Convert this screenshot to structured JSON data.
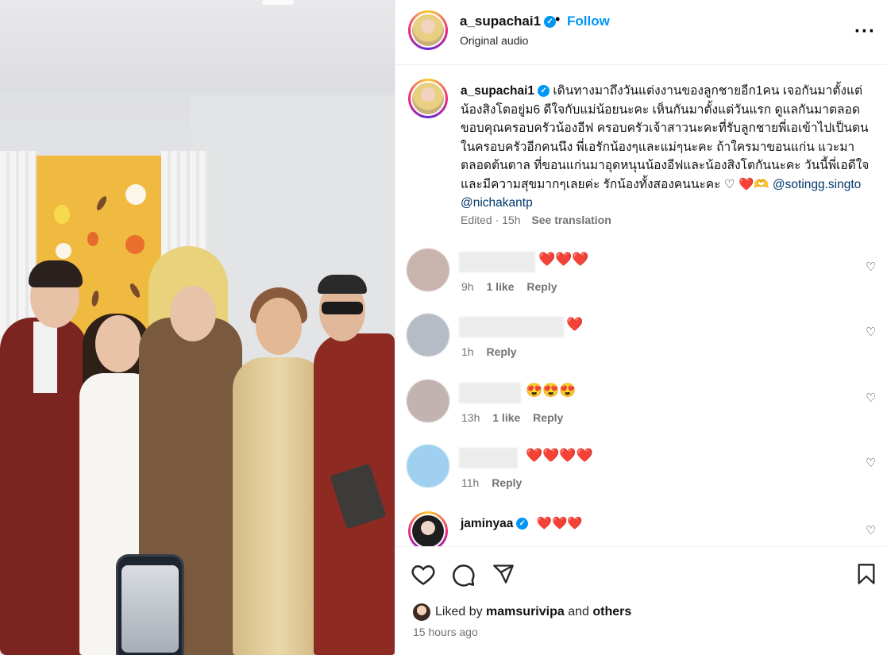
{
  "header": {
    "username": "a_supachai1",
    "separator": "•",
    "follow_label": "Follow",
    "audio_label": "Original audio",
    "more_label": "···"
  },
  "caption": {
    "username": "a_supachai1",
    "text": "เดินทางมาถึงวันแต่งงานของลูกชายอีก1คน เจอกันมาตั้งแต่น้องสิงโตอยู่ม6 ดีใจกับแม่น้อยนะคะ เห็นกันมาตั้งแต่วันแรก ดูแลกันมาตลอด ขอบคุณครอบครัวน้องอีฟ ครอบครัวเจ้าสาวนะคะที่รับลูกชายพี่เอเข้าไปเป็นตนในครอบครัวอีกคนนึง พี่เอรักน้องๆและแม่ๆนะคะ ถ้าใครมาขอนแก่น แวะมาตลอดต้นตาล ที่ขอนแก่นมาอุดหนุนน้องอีฟและน้องสิงโตกันนะคะ วันนี้พี่เอดีใจและมีความสุขมากๆเลยค่ะ รักน้องทั้งสองคนนะคะ ♡ ❤️🫶",
    "tags": "@sotingg.singto @nichakantp",
    "edited": "Edited · 15h",
    "see_translation": "See translation"
  },
  "comments": [
    {
      "text": "❤️❤️❤️",
      "time": "9h",
      "likes": "1 like",
      "reply": "Reply",
      "avatar_color": "#c9b3ad"
    },
    {
      "text": "❤️",
      "time": "1h",
      "likes": "",
      "reply": "Reply",
      "avatar_color": "#b5bcc6"
    },
    {
      "text": "😍😍😍",
      "time": "13h",
      "likes": "1 like",
      "reply": "Reply",
      "avatar_color": "#c2b3b1"
    },
    {
      "text": "❤️❤️❤️❤️",
      "time": "11h",
      "likes": "",
      "reply": "Reply",
      "avatar_color": "#9fd0ef"
    }
  ],
  "jamin_comment": {
    "username": "jaminyaa",
    "text": "❤️❤️❤️"
  },
  "likes": {
    "prefix": "Liked by",
    "user": "mamsurivipa",
    "and": "and",
    "others": "others"
  },
  "timestamp": "15 hours ago",
  "icons": [
    "heart-icon",
    "comment-icon",
    "share-icon",
    "bookmark-icon",
    "verified-icon",
    "more-icon"
  ],
  "colors": {
    "accent": "#0095f6",
    "meta": "#737373",
    "heart": "#ed4956"
  }
}
